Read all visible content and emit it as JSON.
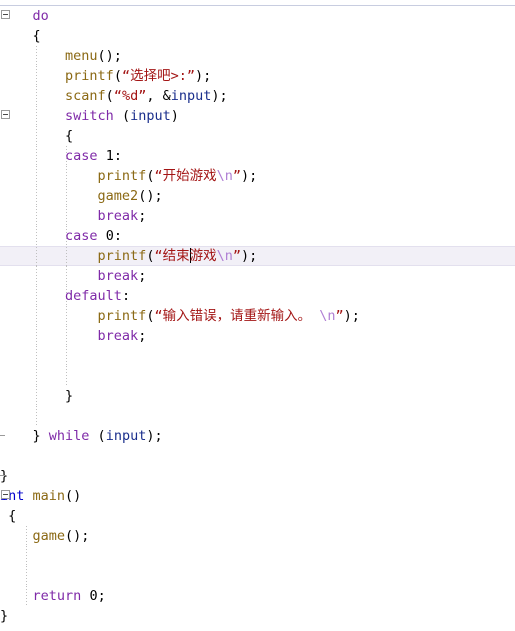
{
  "editor": {
    "name": "code-editor",
    "language": "C",
    "font_size_px": 13.5,
    "line_height_px": 20,
    "background": "#ffffff",
    "current_line_background": "#f2f0f7",
    "current_line_border": "#e3e0ee",
    "top_rule_color": "#c8cde0",
    "indent_guide_color": "#bfbfbf",
    "fold_marker_color": "#9a9a9a",
    "caret_color": "#000000",
    "colors": {
      "keyword": "#7F2AA8",
      "function": "#8B6914",
      "string": "#A31515",
      "escape": "#B07FD4",
      "identifier": "#1A2E8C",
      "type": "#0000CD",
      "punctuation": "#000000",
      "number": "#000000"
    }
  },
  "lines": [
    {
      "id": "line-do",
      "current": false,
      "fold_box": true,
      "guides": [],
      "tokens": [
        {
          "text": "    ",
          "cls": "t-punc"
        },
        {
          "text": "do",
          "cls": "t-kw"
        }
      ]
    },
    {
      "id": "line-open-brace-do",
      "current": false,
      "guides": [],
      "tokens": [
        {
          "text": "    {",
          "cls": "t-punc"
        }
      ]
    },
    {
      "id": "line-menu-call",
      "current": false,
      "guides": [
        36
      ],
      "tokens": [
        {
          "text": "        ",
          "cls": "t-punc"
        },
        {
          "text": "menu",
          "cls": "t-fn"
        },
        {
          "text": "();",
          "cls": "t-punc"
        }
      ]
    },
    {
      "id": "line-printf-choose",
      "current": false,
      "guides": [
        36
      ],
      "tokens": [
        {
          "text": "        ",
          "cls": "t-punc"
        },
        {
          "text": "printf",
          "cls": "t-fn"
        },
        {
          "text": "(",
          "cls": "t-punc"
        },
        {
          "text": "“选择吧>:”",
          "cls": "t-str"
        },
        {
          "text": ");",
          "cls": "t-punc"
        }
      ]
    },
    {
      "id": "line-scanf-input",
      "current": false,
      "guides": [
        36
      ],
      "tokens": [
        {
          "text": "        ",
          "cls": "t-punc"
        },
        {
          "text": "scanf",
          "cls": "t-fn"
        },
        {
          "text": "(",
          "cls": "t-punc"
        },
        {
          "text": "“%d”",
          "cls": "t-str"
        },
        {
          "text": ", &",
          "cls": "t-punc"
        },
        {
          "text": "input",
          "cls": "t-id"
        },
        {
          "text": ");",
          "cls": "t-punc"
        }
      ]
    },
    {
      "id": "line-switch",
      "current": false,
      "fold_box": true,
      "guides": [
        36
      ],
      "tokens": [
        {
          "text": "        ",
          "cls": "t-punc"
        },
        {
          "text": "switch",
          "cls": "t-kw"
        },
        {
          "text": " (",
          "cls": "t-punc"
        },
        {
          "text": "input",
          "cls": "t-id"
        },
        {
          "text": ")",
          "cls": "t-punc"
        }
      ]
    },
    {
      "id": "line-switch-open-brace",
      "current": false,
      "guides": [
        36
      ],
      "tokens": [
        {
          "text": "        {",
          "cls": "t-punc"
        }
      ]
    },
    {
      "id": "line-case-1",
      "current": false,
      "guides": [
        36,
        66
      ],
      "tokens": [
        {
          "text": "        ",
          "cls": "t-punc"
        },
        {
          "text": "case",
          "cls": "t-kw"
        },
        {
          "text": " ",
          "cls": "t-punc"
        },
        {
          "text": "1",
          "cls": "t-num"
        },
        {
          "text": ":",
          "cls": "t-punc"
        }
      ]
    },
    {
      "id": "line-printf-start-game",
      "current": false,
      "guides": [
        36,
        66
      ],
      "tokens": [
        {
          "text": "            ",
          "cls": "t-punc"
        },
        {
          "text": "printf",
          "cls": "t-fn"
        },
        {
          "text": "(",
          "cls": "t-punc"
        },
        {
          "text": "“开始游戏",
          "cls": "t-str"
        },
        {
          "text": "\\n",
          "cls": "t-esc"
        },
        {
          "text": "”",
          "cls": "t-str"
        },
        {
          "text": ");",
          "cls": "t-punc"
        }
      ]
    },
    {
      "id": "line-game2-call",
      "current": false,
      "guides": [
        36,
        66
      ],
      "tokens": [
        {
          "text": "            ",
          "cls": "t-punc"
        },
        {
          "text": "game2",
          "cls": "t-fn"
        },
        {
          "text": "();",
          "cls": "t-punc"
        }
      ]
    },
    {
      "id": "line-break-1",
      "current": false,
      "guides": [
        36,
        66
      ],
      "tokens": [
        {
          "text": "            ",
          "cls": "t-punc"
        },
        {
          "text": "break",
          "cls": "t-kw"
        },
        {
          "text": ";",
          "cls": "t-punc"
        }
      ]
    },
    {
      "id": "line-case-0",
      "current": false,
      "guides": [
        36,
        66
      ],
      "tokens": [
        {
          "text": "        ",
          "cls": "t-punc"
        },
        {
          "text": "case",
          "cls": "t-kw"
        },
        {
          "text": " ",
          "cls": "t-punc"
        },
        {
          "text": "0",
          "cls": "t-num"
        },
        {
          "text": ":",
          "cls": "t-punc"
        }
      ]
    },
    {
      "id": "line-printf-end-game",
      "current": true,
      "guides": [
        36,
        66
      ],
      "tokens": [
        {
          "text": "            ",
          "cls": "t-punc"
        },
        {
          "text": "printf",
          "cls": "t-fn"
        },
        {
          "text": "(",
          "cls": "t-punc"
        },
        {
          "text": "“结束",
          "cls": "t-str"
        },
        {
          "caret": true
        },
        {
          "text": "游戏",
          "cls": "t-str"
        },
        {
          "text": "\\n",
          "cls": "t-esc"
        },
        {
          "text": "”",
          "cls": "t-str"
        },
        {
          "text": ");",
          "cls": "t-punc"
        }
      ]
    },
    {
      "id": "line-break-0",
      "current": false,
      "guides": [
        36,
        66
      ],
      "tokens": [
        {
          "text": "            ",
          "cls": "t-punc"
        },
        {
          "text": "break",
          "cls": "t-kw"
        },
        {
          "text": ";",
          "cls": "t-punc"
        }
      ]
    },
    {
      "id": "line-default",
      "current": false,
      "guides": [
        36,
        66
      ],
      "tokens": [
        {
          "text": "        ",
          "cls": "t-punc"
        },
        {
          "text": "default",
          "cls": "t-kw"
        },
        {
          "text": ":",
          "cls": "t-punc"
        }
      ]
    },
    {
      "id": "line-printf-input-error",
      "current": false,
      "guides": [
        36,
        66
      ],
      "tokens": [
        {
          "text": "            ",
          "cls": "t-punc"
        },
        {
          "text": "printf",
          "cls": "t-fn"
        },
        {
          "text": "(",
          "cls": "t-punc"
        },
        {
          "text": "“输入错误，请重新输入。 ",
          "cls": "t-str"
        },
        {
          "text": "\\n",
          "cls": "t-esc"
        },
        {
          "text": "”",
          "cls": "t-str"
        },
        {
          "text": ");",
          "cls": "t-punc"
        }
      ]
    },
    {
      "id": "line-break-default",
      "current": false,
      "guides": [
        36,
        66
      ],
      "tokens": [
        {
          "text": "            ",
          "cls": "t-punc"
        },
        {
          "text": "break",
          "cls": "t-kw"
        },
        {
          "text": ";",
          "cls": "t-punc"
        }
      ]
    },
    {
      "id": "line-blank-1",
      "current": false,
      "guides": [
        36,
        66
      ],
      "tokens": [
        {
          "text": "",
          "cls": "t-punc"
        }
      ]
    },
    {
      "id": "line-blank-2",
      "current": false,
      "guides": [
        36,
        66
      ],
      "tokens": [
        {
          "text": "",
          "cls": "t-punc"
        }
      ]
    },
    {
      "id": "line-switch-close-brace",
      "current": false,
      "guides": [
        36
      ],
      "tokens": [
        {
          "text": "        }",
          "cls": "t-punc"
        }
      ]
    },
    {
      "id": "line-blank-3",
      "current": false,
      "guides": [
        36
      ],
      "tokens": [
        {
          "text": "",
          "cls": "t-punc"
        }
      ]
    },
    {
      "id": "line-while",
      "current": false,
      "fold_tick": true,
      "guides": [],
      "tokens": [
        {
          "text": "    } ",
          "cls": "t-punc"
        },
        {
          "text": "while",
          "cls": "t-kw"
        },
        {
          "text": " (",
          "cls": "t-punc"
        },
        {
          "text": "input",
          "cls": "t-id"
        },
        {
          "text": ");",
          "cls": "t-punc"
        }
      ]
    },
    {
      "id": "line-blank-4",
      "current": false,
      "guides": [],
      "tokens": [
        {
          "text": "",
          "cls": "t-punc"
        }
      ]
    },
    {
      "id": "line-game-close-brace",
      "current": false,
      "fold_tick": true,
      "guides": [],
      "tokens": [
        {
          "text": "}",
          "cls": "t-punc"
        }
      ]
    },
    {
      "id": "line-int-main",
      "current": false,
      "fold_box": true,
      "guides": [],
      "tokens": [
        {
          "text": "int",
          "cls": "t-type"
        },
        {
          "text": " ",
          "cls": "t-punc"
        },
        {
          "text": "main",
          "cls": "t-fn"
        },
        {
          "text": "()",
          "cls": "t-punc"
        }
      ]
    },
    {
      "id": "line-main-open-brace",
      "current": false,
      "guides": [],
      "tokens": [
        {
          "text": " {",
          "cls": "t-punc"
        }
      ]
    },
    {
      "id": "line-game-call",
      "current": false,
      "guides": [
        26
      ],
      "tokens": [
        {
          "text": "    ",
          "cls": "t-punc"
        },
        {
          "text": "game",
          "cls": "t-fn"
        },
        {
          "text": "();",
          "cls": "t-punc"
        }
      ]
    },
    {
      "id": "line-blank-5",
      "current": false,
      "guides": [
        26
      ],
      "tokens": [
        {
          "text": "",
          "cls": "t-punc"
        }
      ]
    },
    {
      "id": "line-blank-6",
      "current": false,
      "guides": [
        26
      ],
      "tokens": [
        {
          "text": "",
          "cls": "t-punc"
        }
      ]
    },
    {
      "id": "line-return-0",
      "current": false,
      "guides": [
        26
      ],
      "tokens": [
        {
          "text": "    ",
          "cls": "t-punc"
        },
        {
          "text": "return",
          "cls": "t-kw"
        },
        {
          "text": " ",
          "cls": "t-punc"
        },
        {
          "text": "0",
          "cls": "t-num"
        },
        {
          "text": ";",
          "cls": "t-punc"
        }
      ]
    },
    {
      "id": "line-main-close-brace",
      "current": false,
      "guides": [],
      "tokens": [
        {
          "text": "}",
          "cls": "t-punc"
        }
      ]
    }
  ]
}
